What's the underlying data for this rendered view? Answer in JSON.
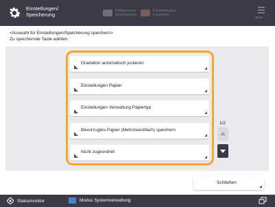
{
  "header": {
    "title": "Einstellungen/\nSpeicherung",
    "btn1_label": "Präferenzen\n(Funktionen)",
    "btn2_label": "Einstellungen\nFavoriten",
    "menu_label": "Menü"
  },
  "instruction": "<Auswahl für Einstellungen/Speicherung speichern>\nZu speichernde Taste wählen.",
  "list": {
    "items": [
      {
        "label": "Gradation automatisch justieren"
      },
      {
        "label": "Einstellungen Papier"
      },
      {
        "label": "Einstellungen Verwaltung Papiertyp"
      },
      {
        "label": "Bevorzugtes Papier (Mehrzweckfach) speichern"
      },
      {
        "label": "Nicht zugeordnet"
      }
    ]
  },
  "page_indicator": "1/2",
  "close_button": {
    "label": "Schließen"
  },
  "footer": {
    "status_label": "Statusmonitor",
    "mode_label": "Modus Systemverwaltung"
  },
  "colors": {
    "header_bg": "#3a3b44",
    "highlight_border": "#f5a623",
    "panel_bg": "#ebebef"
  }
}
